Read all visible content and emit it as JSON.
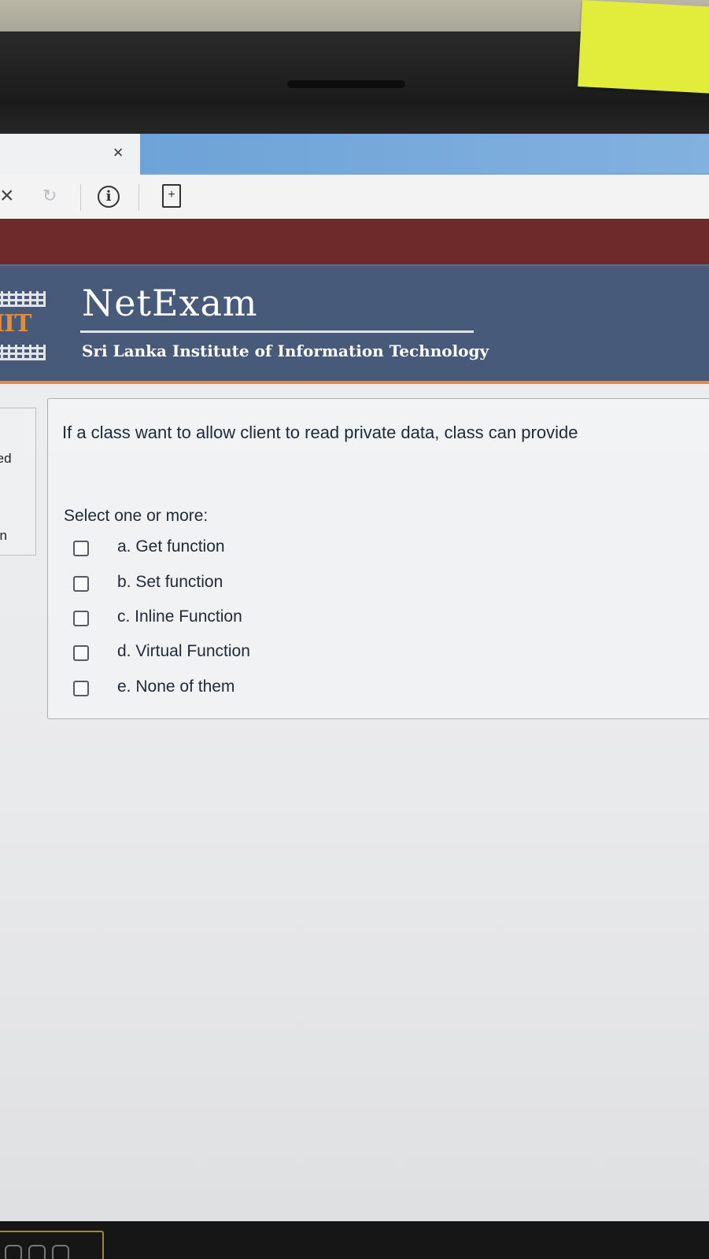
{
  "browser": {
    "tab_close": "×",
    "stop": "×",
    "reload": "↻",
    "info": "i",
    "page_action": "+"
  },
  "header": {
    "logo_text": "IIT",
    "brand": "NetExam",
    "subtitle": "Sri Lanka Institute of Information Technology"
  },
  "nav": {
    "line1": "red",
    "line2": "on"
  },
  "question": {
    "text": "If a class want to allow client to read private data, class can provide",
    "prompt": "Select one or more:",
    "options": [
      {
        "label": "a. Get function",
        "checked": false
      },
      {
        "label": "b. Set function",
        "checked": false
      },
      {
        "label": "c. Inline Function",
        "checked": false
      },
      {
        "label": "d. Virtual Function",
        "checked": false
      },
      {
        "label": "e. None of them",
        "checked": false
      }
    ]
  },
  "colors": {
    "header_bg": "#475a79",
    "maroon_bar": "#6e2a2a",
    "accent_orange": "#e8893f",
    "tab_blue": "#7aa8d5",
    "sticky_note": "#e2ec3a"
  }
}
